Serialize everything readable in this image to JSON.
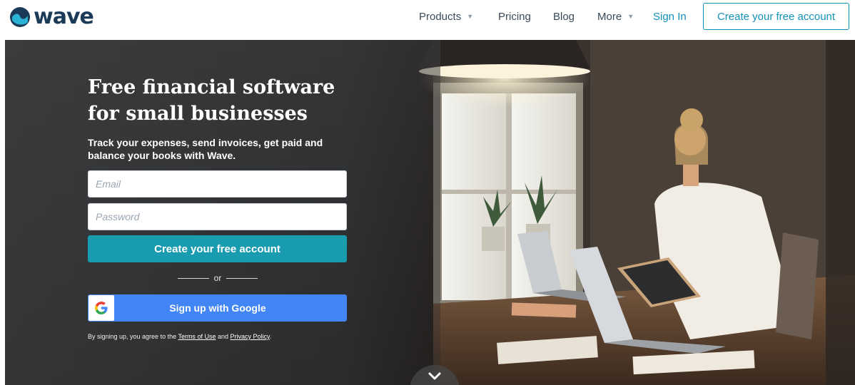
{
  "brand": {
    "name": "wave",
    "color": "#1b3a57",
    "accent": "#1591b8"
  },
  "nav": {
    "items": [
      {
        "label": "Products",
        "has_dropdown": true
      },
      {
        "label": "Pricing",
        "has_dropdown": false
      },
      {
        "label": "Blog",
        "has_dropdown": false
      },
      {
        "label": "More",
        "has_dropdown": true
      }
    ],
    "sign_in": "Sign In",
    "cta": "Create your free account"
  },
  "hero": {
    "title_line1": "Free financial software",
    "title_line2": "for small businesses",
    "subtitle": "Track your expenses, send invoices, get paid and balance your books with Wave."
  },
  "form": {
    "email_placeholder": "Email",
    "password_placeholder": "Password",
    "submit_label": "Create your free account",
    "submit_color": "#1a9cb0",
    "or_label": "or",
    "google_label": "Sign up with Google",
    "google_color": "#4285f4",
    "terms_prefix": "By signing up, you agree to the",
    "terms_link": "Terms of Use",
    "terms_and": "and",
    "privacy_link": "Privacy Policy",
    "terms_suffix": "."
  },
  "icons": {
    "logo": "wave-logo-icon",
    "google": "google-g-icon",
    "scroll": "chevron-down-icon",
    "caret": "caret-down-icon"
  }
}
